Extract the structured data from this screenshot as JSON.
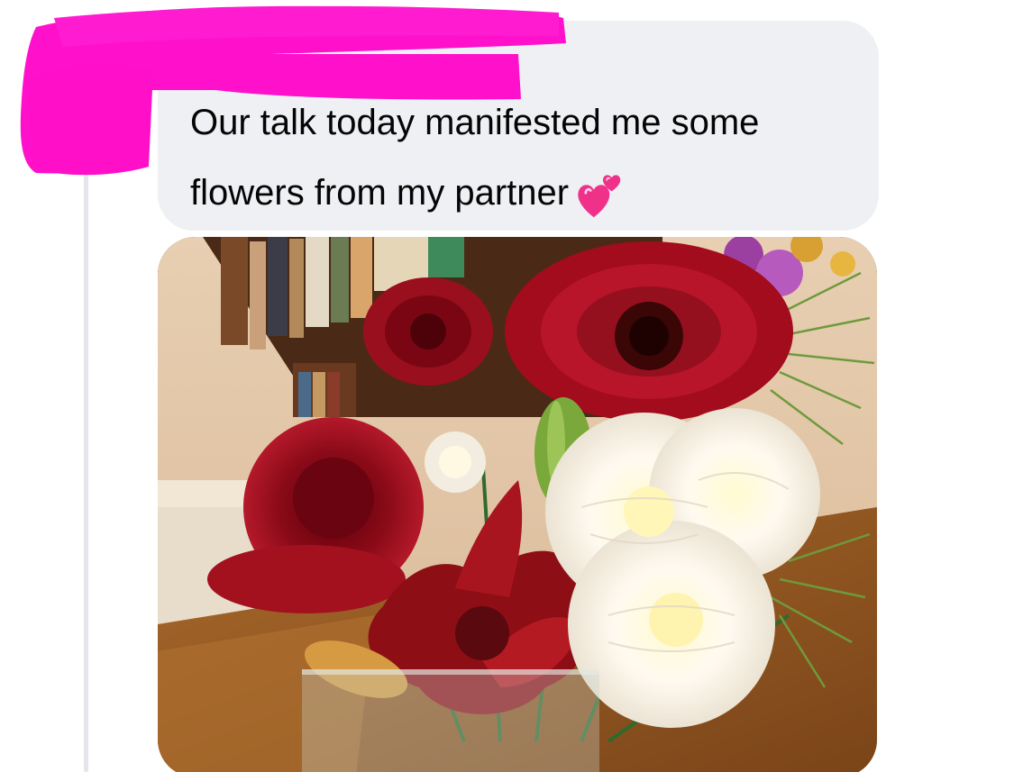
{
  "message": {
    "text": "Our talk today manifested me some\nflowers from my partner",
    "emoji": "two-hearts-icon"
  },
  "attachment": {
    "type": "photo",
    "subject": "flower-bouquet-photo"
  },
  "redaction": {
    "color": "#ff11cc"
  },
  "colors": {
    "bubble_bg": "#eff0f3",
    "text": "#050505",
    "thread_line": "#e4e6eb"
  }
}
